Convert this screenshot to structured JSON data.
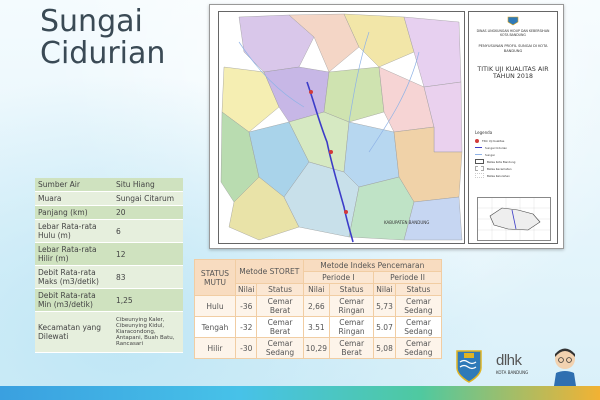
{
  "title_line1": "Sungai",
  "title_line2": "Cidurian",
  "river_info": [
    {
      "label": "Sumber Air",
      "value": "Situ Hiang"
    },
    {
      "label": "Muara",
      "value": "Sungai Citarum"
    },
    {
      "label": "Panjang (km)",
      "value": "20"
    },
    {
      "label": "Lebar Rata-rata Hulu (m)",
      "value": "6"
    },
    {
      "label": "Lebar Rata-rata Hilir (m)",
      "value": "12"
    },
    {
      "label": "Debit Rata-rata Maks (m3/detik)",
      "value": "83"
    },
    {
      "label": "Debit Rata-rata Min (m3/detik)",
      "value": "1,25"
    },
    {
      "label": "Kecamatan yang Dilewati",
      "value": "Cibeunying Kaler, Cibeunying Kidul, Kiaracondong, Antapani, Buah Batu, Rancasari"
    }
  ],
  "map": {
    "agency": "DINAS LINGKUNGAN HIDUP DAN KEBERSIHAN KOTA BANDUNG",
    "project": "PENYUSUNAN PROFIL SUNGAI DI KOTA BANDUNG",
    "map_title": "TITIK UJI KUALITAS AIR TAHUN 2018",
    "legend_title": "Legenda",
    "legend": [
      {
        "label": "Titik Uji Kualitas",
        "color": "#d23a3a"
      },
      {
        "label": "Sungai Cidurian",
        "color": "#3c3cc8"
      },
      {
        "label": "Sungai",
        "color": "#8fb3e6"
      },
      {
        "label": "Batas Kota Bandung",
        "color": "#555555"
      },
      {
        "label": "Batas Kecamatan",
        "color": "#aaaaaa"
      },
      {
        "label": "Batas Kelurahan",
        "color": "#cccccc"
      }
    ],
    "map_label": "KABUPATEN BANDUNG"
  },
  "quality": {
    "status_header": "STATUS MUTU",
    "storet_header": "Metode STORET",
    "ip_header": "Metode Indeks Pencemaran",
    "period1": "Periode I",
    "period2": "Periode II",
    "nilai": "Nilai",
    "status": "Status",
    "rows": [
      {
        "label": "Hulu",
        "storet_nilai": "-36",
        "storet_status": "Cemar Berat",
        "p1_nilai": "2,66",
        "p1_status": "Cemar Ringan",
        "p2_nilai": "5,73",
        "p2_status": "Cemar Sedang"
      },
      {
        "label": "Tengah",
        "storet_nilai": "-32",
        "storet_status": "Cemar Berat",
        "p1_nilai": "3.51",
        "p1_status": "Cemar Ringan",
        "p2_nilai": "5.07",
        "p2_status": "Cemar Sedang"
      },
      {
        "label": "Hilir",
        "storet_nilai": "-30",
        "storet_status": "Cemar Sedang",
        "p1_nilai": "10,29",
        "p1_status": "Cemar Berat",
        "p2_nilai": "5,08",
        "p2_status": "Cemar Sedang"
      }
    ]
  },
  "footer": {
    "dlhk_logo": "dlhk",
    "dlhk_caption": "KOTA BANDUNG"
  },
  "colors": {
    "accent_table": "#cfe2bf",
    "header_table": "#f8dcc0"
  }
}
